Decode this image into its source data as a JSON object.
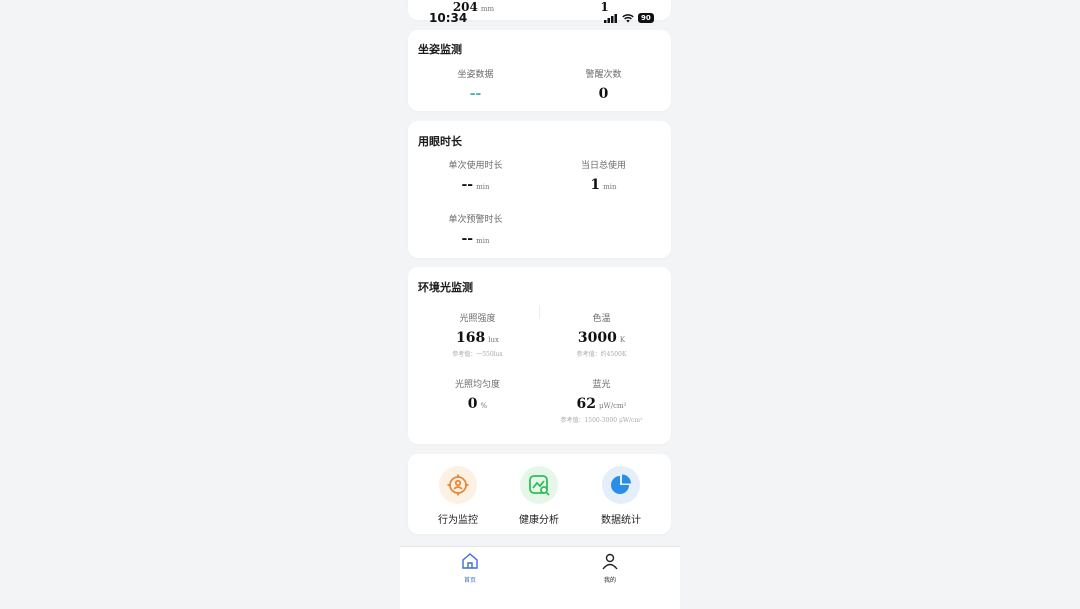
{
  "status_bar": {
    "time": "10:34",
    "battery": "90"
  },
  "top_partial": {
    "left_value": "204",
    "left_unit": "mm",
    "right_value": "1"
  },
  "posture": {
    "title": "坐姿监测",
    "items": [
      {
        "label": "坐姿数据",
        "value": "--"
      },
      {
        "label": "警醒次数",
        "value": "0"
      }
    ]
  },
  "eye_time": {
    "title": "用眼时长",
    "items": [
      {
        "label": "单次使用时长",
        "value": "--",
        "unit": "min"
      },
      {
        "label": "当日总使用",
        "value": "1",
        "unit": "min"
      },
      {
        "label": "单次预警时长",
        "value": "--",
        "unit": "min"
      }
    ]
  },
  "ambient": {
    "title": "环境光监测",
    "items": [
      {
        "label": "光照强度",
        "value": "168",
        "unit": "lux",
        "ref": "参考值：一550lux"
      },
      {
        "label": "色温",
        "value": "3000",
        "unit": "K",
        "ref": "参考值：约4500K"
      },
      {
        "label": "光照均匀度",
        "value": "0",
        "unit": "%"
      },
      {
        "label": "蓝光",
        "value": "62",
        "unit": "μW/cm²",
        "ref": "参考值：1500-3000 μW/cm²"
      }
    ]
  },
  "quick_actions": [
    {
      "label": "行为监控",
      "icon": "target-person-icon",
      "color": "#e8883a",
      "bg": "#fdf1e4"
    },
    {
      "label": "健康分析",
      "icon": "health-chart-icon",
      "color": "#2fbf5a",
      "bg": "#e6f7ea"
    },
    {
      "label": "数据统计",
      "icon": "pie-chart-icon",
      "color": "#2a8ee6",
      "bg": "#e4effa"
    }
  ],
  "tabbar": {
    "items": [
      {
        "label": "首页",
        "icon": "home-icon",
        "active": true
      },
      {
        "label": "我的",
        "icon": "user-icon",
        "active": false
      }
    ],
    "active_color": "#3b6fd6"
  }
}
